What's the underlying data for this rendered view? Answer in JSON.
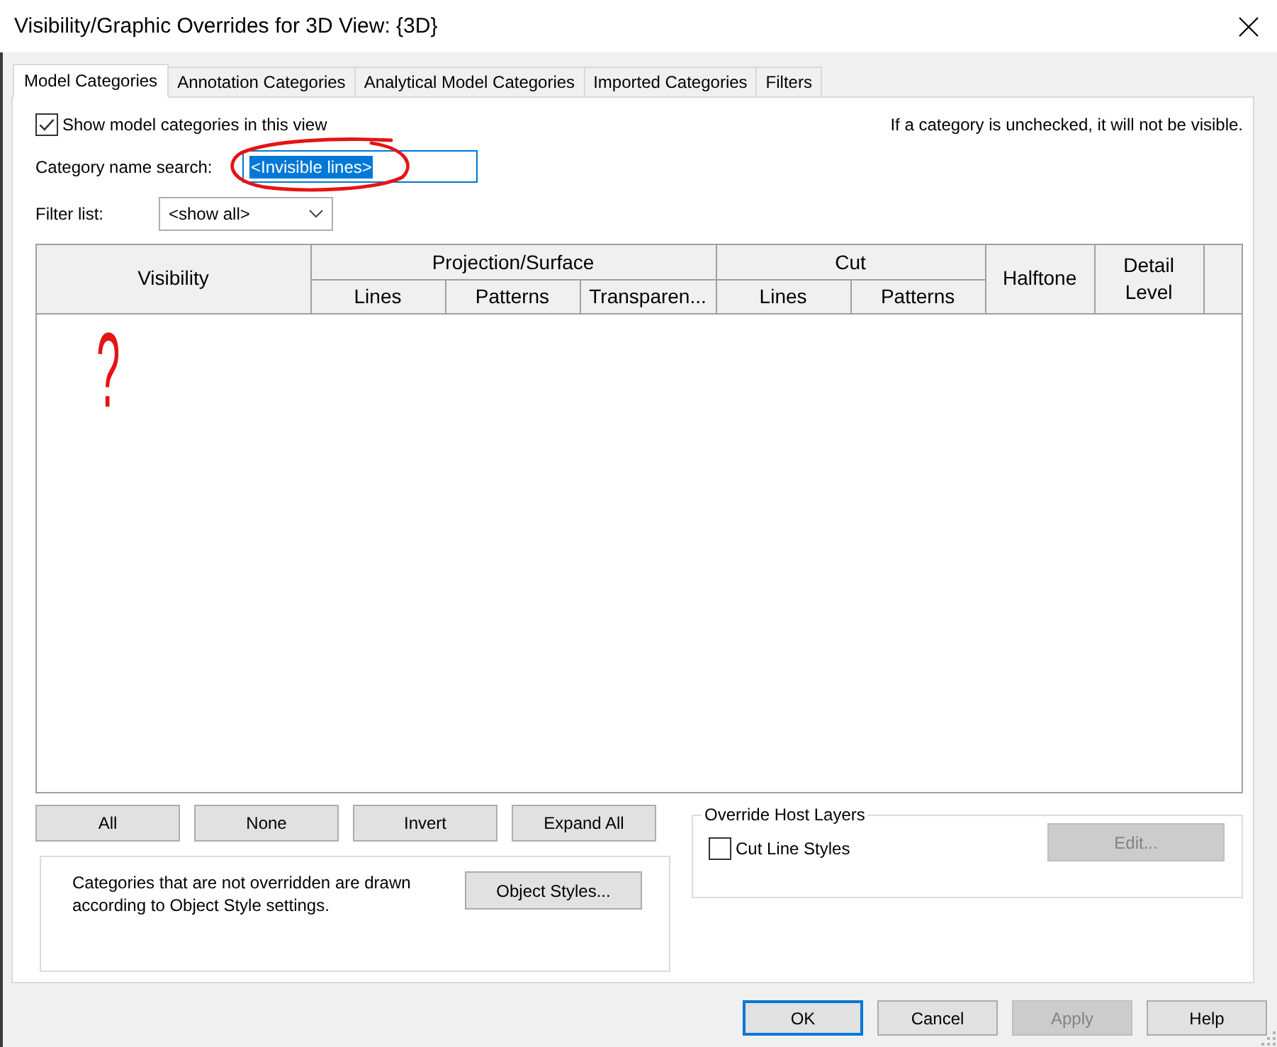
{
  "window": {
    "title": "Visibility/Graphic Overrides for 3D View: {3D}"
  },
  "tabs": [
    {
      "label": "Model Categories",
      "selected": true
    },
    {
      "label": "Annotation Categories",
      "selected": false
    },
    {
      "label": "Analytical Model Categories",
      "selected": false
    },
    {
      "label": "Imported Categories",
      "selected": false
    },
    {
      "label": "Filters",
      "selected": false
    }
  ],
  "show_categories": {
    "label": "Show model categories in this view",
    "checked": true
  },
  "hint": "If a category is unchecked, it will not be visible.",
  "search": {
    "label": "Category name search:",
    "value": "<Invisible lines>",
    "focused": true,
    "circled": true
  },
  "filter": {
    "label": "Filter list:",
    "value": "<show all>"
  },
  "table": {
    "columns": [
      {
        "label": "Visibility"
      },
      {
        "label": "Projection/Surface",
        "subcolumns": [
          {
            "label": "Lines"
          },
          {
            "label": "Patterns"
          },
          {
            "label": "Transparen..."
          }
        ]
      },
      {
        "label": "Cut",
        "subcolumns": [
          {
            "label": "Lines"
          },
          {
            "label": "Patterns"
          }
        ]
      },
      {
        "label": "Halftone"
      },
      {
        "label": "Detail Level"
      }
    ],
    "note": "?"
  },
  "bulk_buttons": [
    "All",
    "None",
    "Invert",
    "Expand All"
  ],
  "info": {
    "text": "Categories that are not overridden are drawn according to Object Style settings.",
    "button": "Object Styles..."
  },
  "host_layers": {
    "title": "Override Host Layers",
    "checkbox": {
      "label": "Cut Line Styles",
      "checked": false
    },
    "edit_button": {
      "label": "Edit...",
      "disabled": true
    }
  },
  "footer_buttons": [
    {
      "label": "OK",
      "default": true,
      "disabled": false
    },
    {
      "label": "Cancel",
      "default": false,
      "disabled": false
    },
    {
      "label": "Apply",
      "default": false,
      "disabled": true
    },
    {
      "label": "Help",
      "default": false,
      "disabled": false
    }
  ]
}
